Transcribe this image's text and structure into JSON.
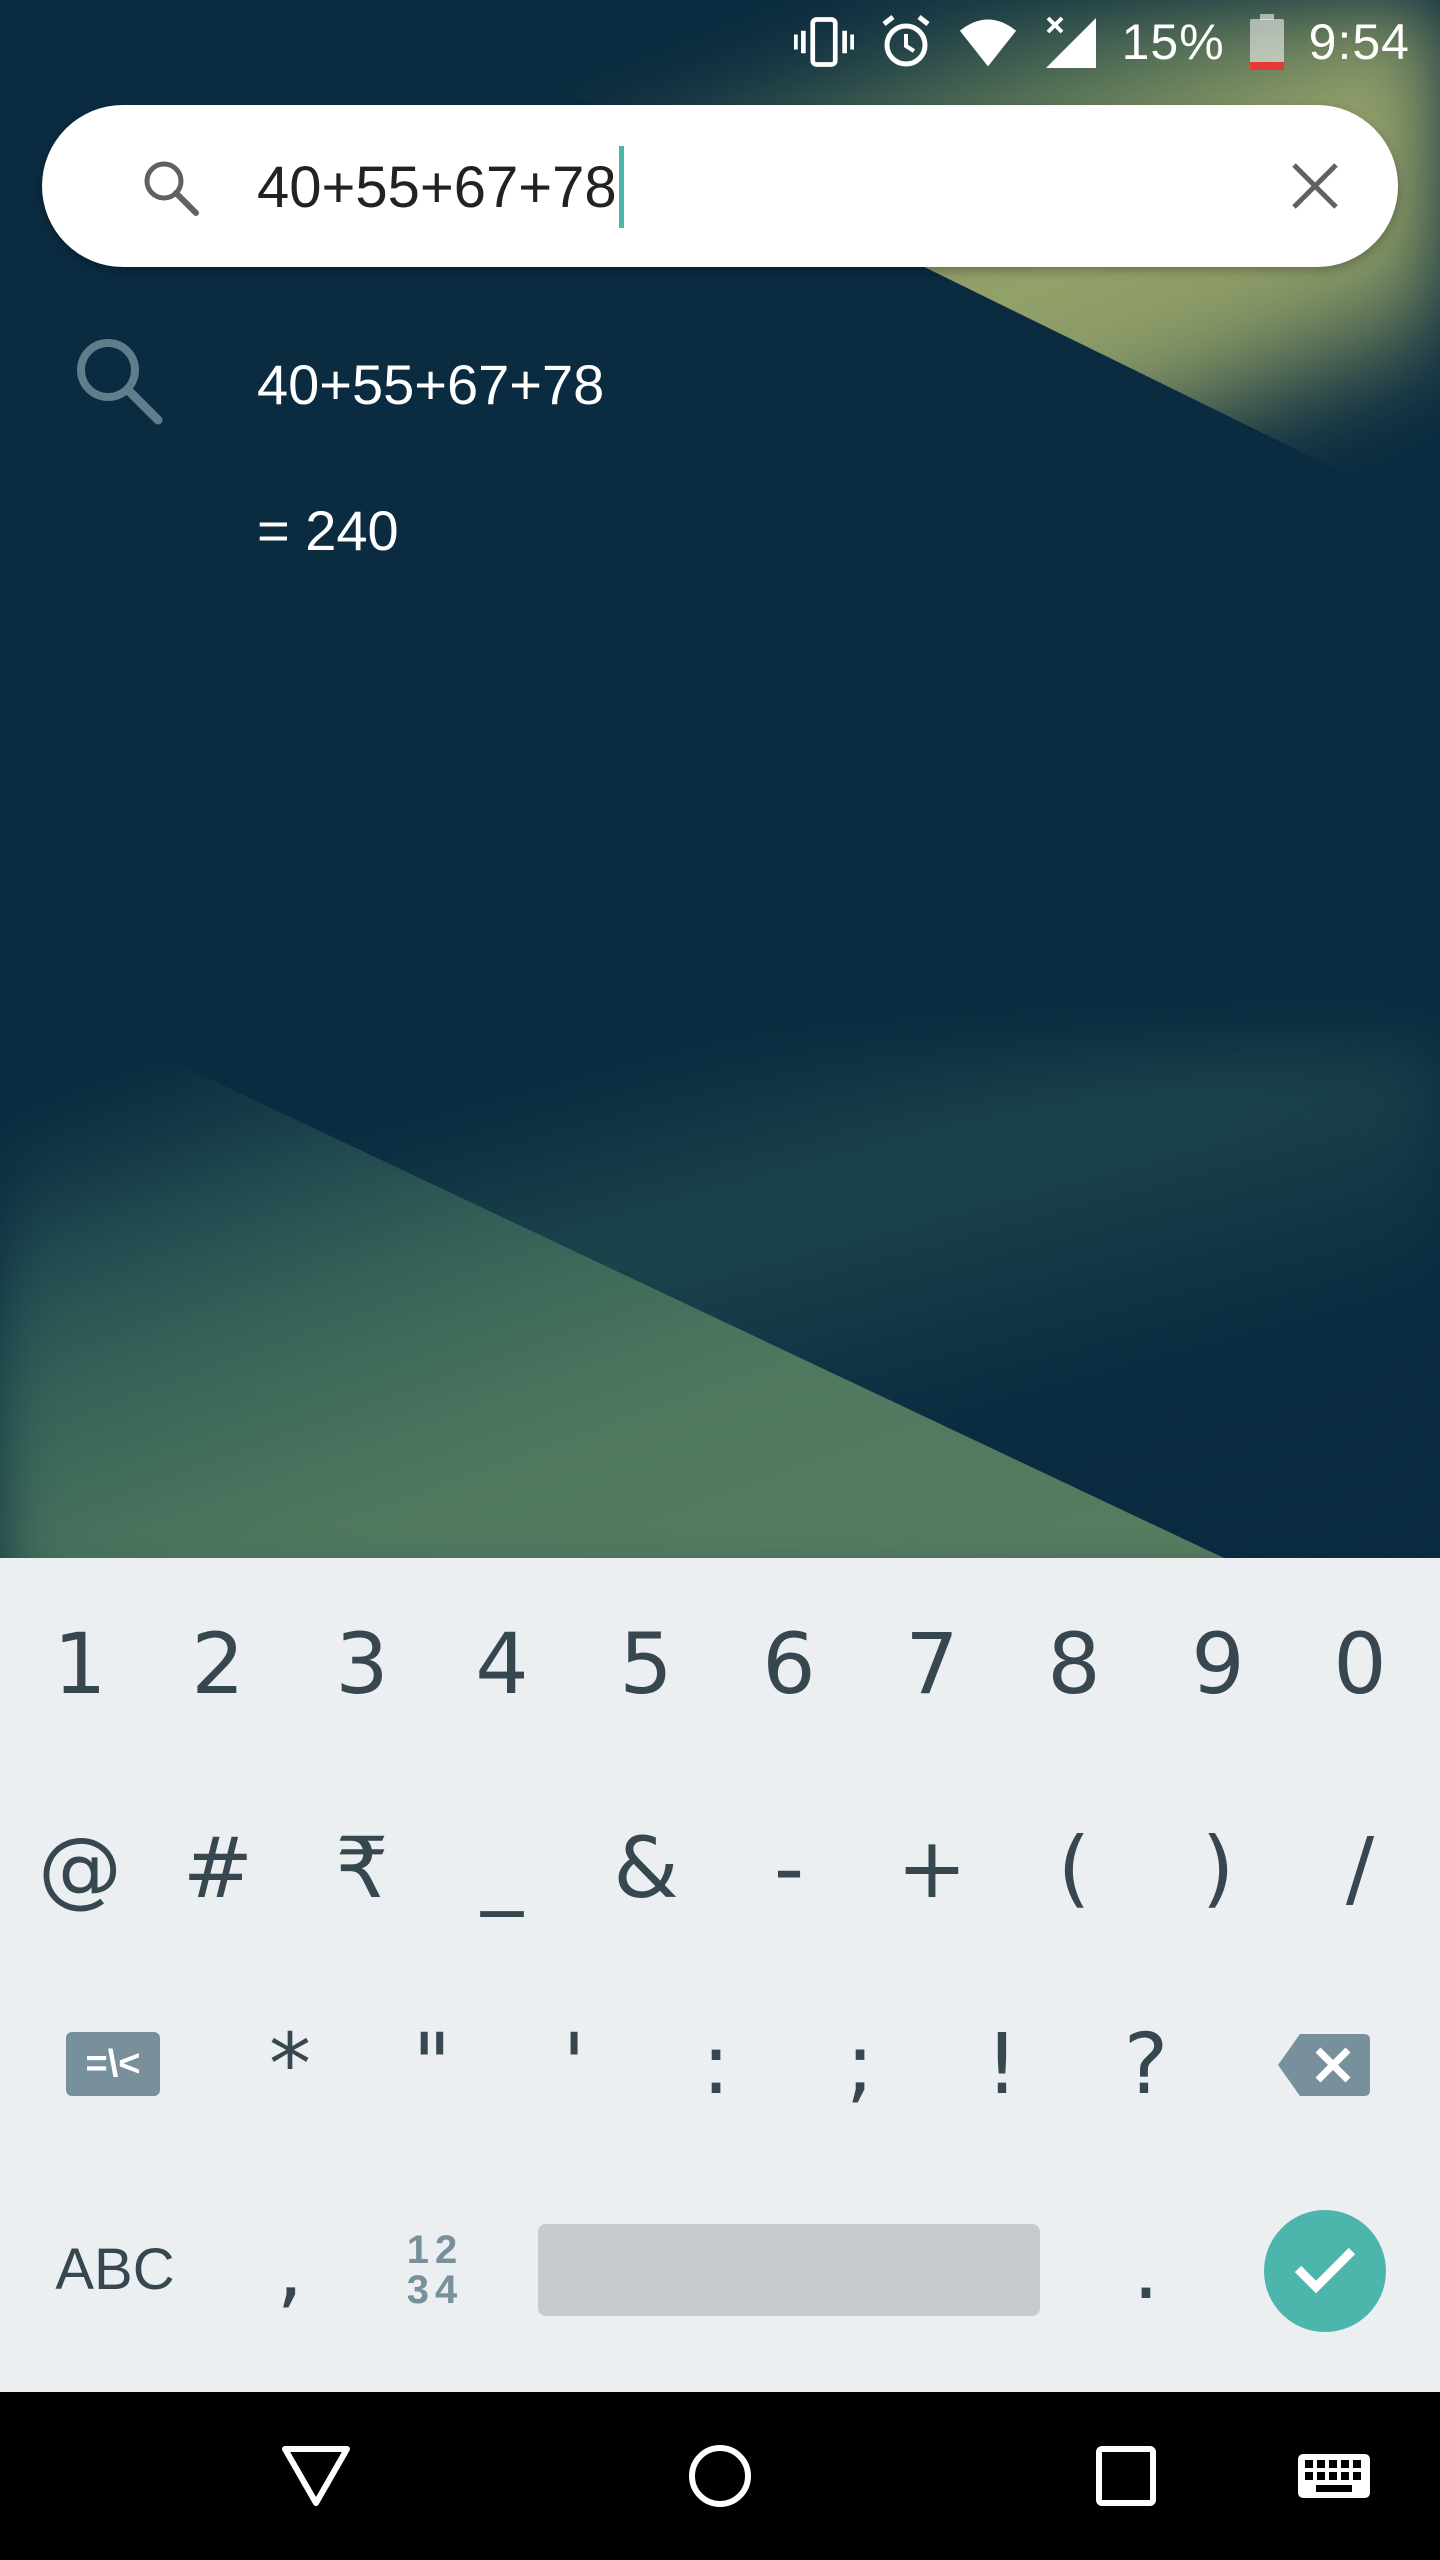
{
  "status_bar": {
    "battery_percent": "15%",
    "time": "9:54",
    "icons": [
      "vibrate-icon",
      "alarm-icon",
      "wifi-icon",
      "cell-signal-icon",
      "battery-icon"
    ],
    "battery_level": 0.15,
    "battery_low_color": "#e53935"
  },
  "search": {
    "query": "40+55+67+78",
    "caret_color": "#4db6ac"
  },
  "suggestions": [
    {
      "text": "40+55+67+78",
      "icon": "search-icon"
    }
  ],
  "result": {
    "text": "= 240"
  },
  "keyboard": {
    "row1": [
      "1",
      "2",
      "3",
      "4",
      "5",
      "6",
      "7",
      "8",
      "9",
      "0"
    ],
    "row2": [
      "@",
      "#",
      "₹",
      "_",
      "&",
      "-",
      "+",
      "(",
      ")",
      "/"
    ],
    "row3": [
      "*",
      "\"",
      "'",
      ":",
      ";",
      "!",
      "?"
    ],
    "mode_key_label": "=\\<",
    "abc_label": "ABC",
    "comma": ",",
    "numpad_top": "12",
    "numpad_bottom": "34",
    "period": ".",
    "accent_color": "#4db6ac",
    "background_color": "#eceff1"
  },
  "nav_bar": {
    "buttons": [
      "back-icon",
      "home-icon",
      "recents-icon",
      "keyboard-switch-icon"
    ]
  }
}
